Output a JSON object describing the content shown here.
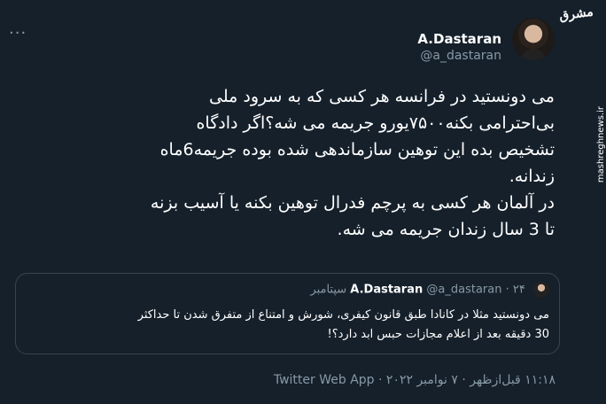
{
  "tweet": {
    "more_label": "···",
    "author_name": "A.Dastaran",
    "author_handle": "@a_dastaran",
    "body_lines": [
      "می دونستید در فرانسه هر کسی که به سرود ملی",
      "بی‌احترامی بکنه۷۵۰۰یورو جریمه می شه؟اگر دادگاه",
      "تشخیص بده این توهین سازماندهی شده بوده جریمه6ماه",
      "زندانه.",
      "در آلمان هر کسی به پرچم فدرال توهین بکنه یا آسیب بزنه",
      "تا 3 سال زندان جریمه می شه."
    ],
    "timestamp": "۱۱:۱۸ قبل‌ازظهر · ۷ نوامبر ۲۰۲۲ · Twitter Web App"
  },
  "quoted": {
    "author_name": "A.Dastaran",
    "author_handle": "@a_dastaran",
    "separator": "·",
    "date": "۲۴ سپتامبر",
    "text_lines": [
      "می دونستید مثلا در کانادا طبق قانون کیفری، شورش و امتناع از متفرق شدن تا حداکثر",
      "30 دقیقه بعد از اعلام مجازات حبس ابد دارد؟!"
    ]
  },
  "watermark": {
    "logo_text": "مشرق",
    "url": "mashreghnews.ir"
  }
}
